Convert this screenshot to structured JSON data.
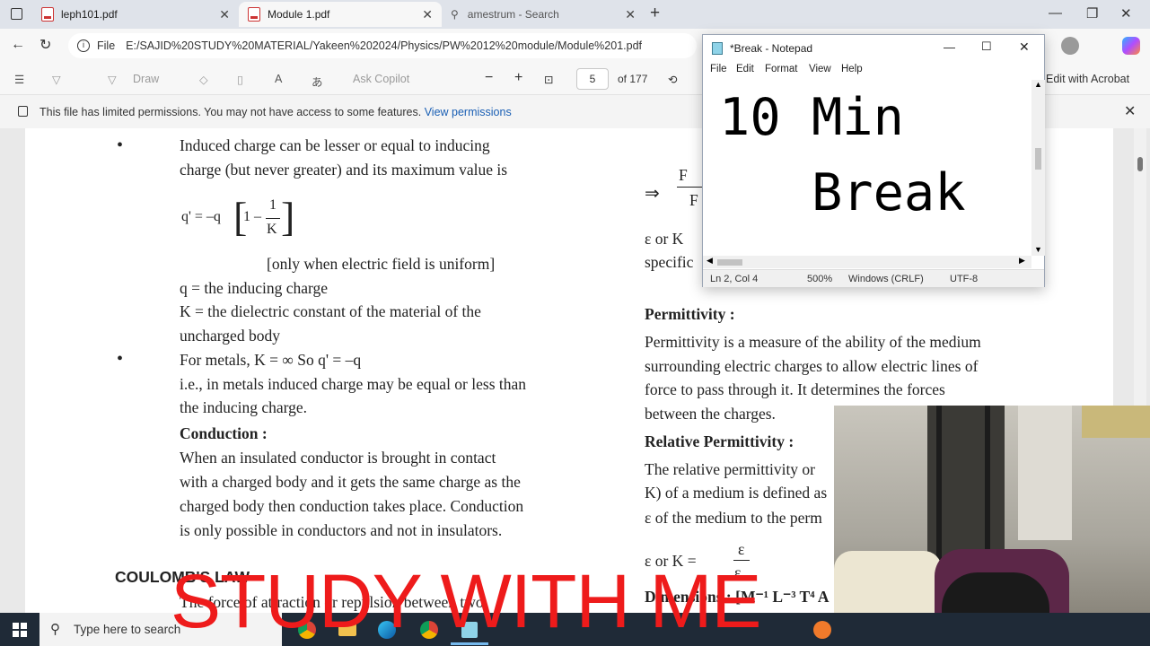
{
  "browser": {
    "tabs": [
      {
        "label": "leph101.pdf"
      },
      {
        "label": "Module 1.pdf"
      },
      {
        "label": "amestrum - Search"
      }
    ],
    "url_prefix": "File",
    "url": "E:/SAJID%20STUDY%20MATERIAL/Yakeen%202024/Physics/PW%2012%20module/Module%201.pdf"
  },
  "pdf_toolbar": {
    "draw": "Draw",
    "ask_copilot": "Ask Copilot",
    "page": "5",
    "page_total": "of 177",
    "edit_with_acrobat": "Edit with Acrobat"
  },
  "permission_bar": {
    "message": "This file has limited permissions. You may not have access to some features.",
    "link": "View permissions"
  },
  "document": {
    "left": {
      "p1a": "Induced charge can be lesser or equal to inducing",
      "p1b": "charge (but never greater) and its maximum value is",
      "formula_q": "q' = –q",
      "formula_1": "1 –",
      "formula_num": "1",
      "formula_den": "K",
      "uniform": "[only when electric field is uniform]",
      "q_def": "q = the inducing charge",
      "k_def_a": "K = the dielectric constant of the material of the",
      "k_def_b": "uncharged body",
      "metals": "For metals,  K = ∞  So q' = –q",
      "ie_a": "i.e., in metals induced charge may be equal or less than",
      "ie_b": "the inducing charge.",
      "conduction_heading": "Conduction :",
      "c1": "When an insulated conductor is brought in contact",
      "c2": "with a charged body and it gets the same charge as the",
      "c3": "charged body then conduction takes place. Conduction",
      "c4": "is only possible in conductors and not in insulators.",
      "coulomb_heading": "COULOMB'S LAW",
      "coulomb_text": "The force of attraction or repulsion between two"
    },
    "right": {
      "arrow": "⇒",
      "frac_num": "F",
      "frac_den": "F",
      "er_line": "ε  or K",
      "specific": "specific",
      "permittivity_heading": "Permittivity :",
      "pm1": "Permittivity is a measure of the ability of the medium",
      "pm2": "surrounding electric charges to allow electric lines of",
      "pm3": "force to pass through it. It determines the forces",
      "pm4": "between the charges.",
      "relative_heading": "Relative Permittivity :",
      "rp1": "The relative permittivity or",
      "rp2": "K) of a medium is defined as",
      "rp3": "ε  of the medium to the perm",
      "er_formula": "ε  or  K =",
      "eps": "ε",
      "eps0": "ε",
      "dimensions": "Dimensions : [M⁻¹ L⁻³ T⁴ A"
    }
  },
  "notepad": {
    "title": "*Break - Notepad",
    "menu": [
      "File",
      "Edit",
      "Format",
      "View",
      "Help"
    ],
    "text_line1": "10 Min",
    "text_line2": "   Break",
    "status": {
      "position": "Ln 2, Col 4",
      "zoom": "500%",
      "line_ending": "Windows (CRLF)",
      "encoding": "UTF-8"
    }
  },
  "taskbar": {
    "search_placeholder": "Type here to search"
  },
  "overlay_text": "STUDY WITH ME",
  "colors": {
    "overlay": "#ee1b1b",
    "link": "#1a5fb4",
    "taskbar": "#1f2a37"
  }
}
